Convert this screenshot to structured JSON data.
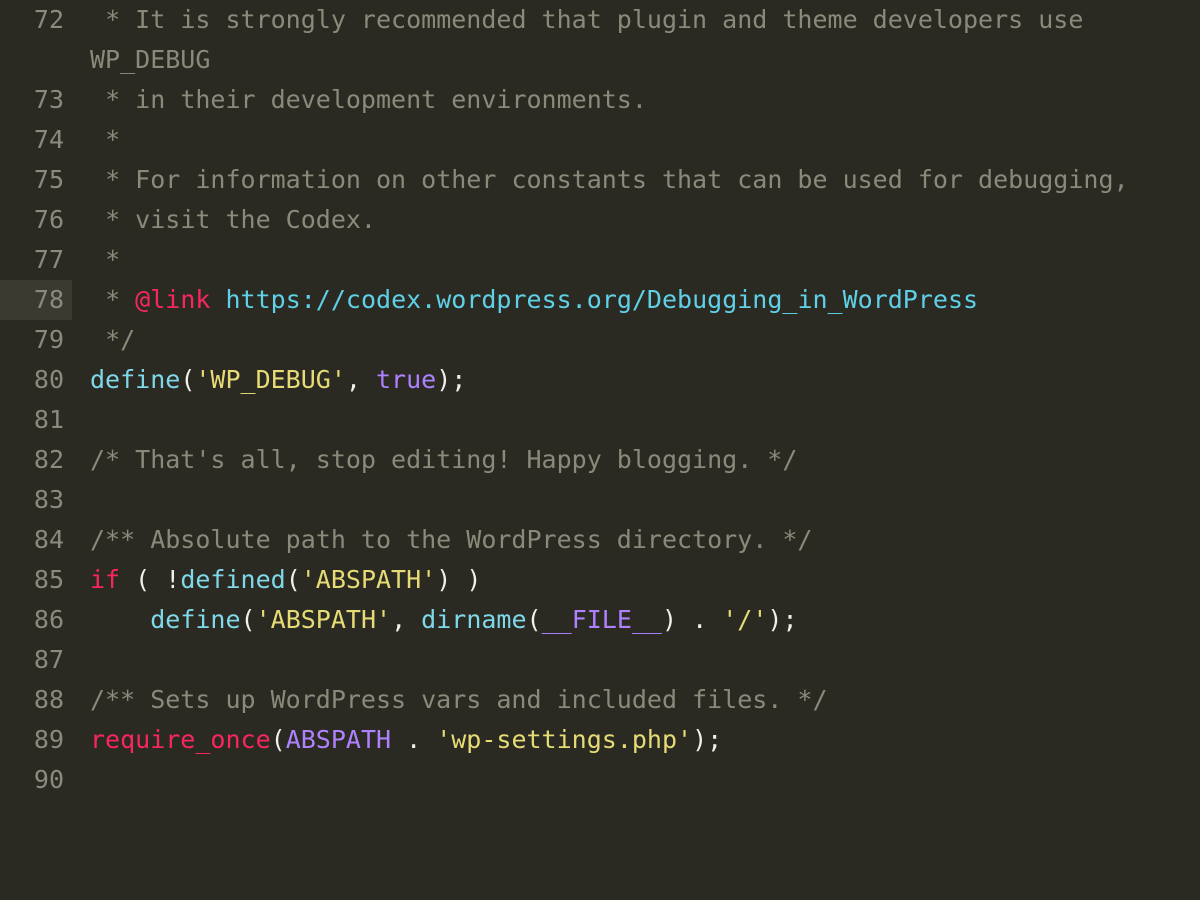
{
  "editor": {
    "highlighted_line": 78,
    "lines": [
      {
        "num": 72,
        "segments": [
          {
            "cls": "tok-comment",
            "text": " * It is strongly recommended that plugin and theme developers use WP_DEBUG"
          }
        ]
      },
      {
        "num": 73,
        "segments": [
          {
            "cls": "tok-comment",
            "text": " * in their development environments."
          }
        ]
      },
      {
        "num": 74,
        "segments": [
          {
            "cls": "tok-comment",
            "text": " *"
          }
        ]
      },
      {
        "num": 75,
        "segments": [
          {
            "cls": "tok-comment",
            "text": " * For information on other constants that can be used for debugging,"
          }
        ]
      },
      {
        "num": 76,
        "segments": [
          {
            "cls": "tok-comment",
            "text": " * visit the Codex."
          }
        ]
      },
      {
        "num": 77,
        "segments": [
          {
            "cls": "tok-comment",
            "text": " *"
          }
        ]
      },
      {
        "num": 78,
        "segments": [
          {
            "cls": "tok-comment",
            "text": " * "
          },
          {
            "cls": "tok-tag",
            "text": "@link"
          },
          {
            "cls": "tok-comment",
            "text": " "
          },
          {
            "cls": "tok-url",
            "text": "https://codex.wordpress.org/Debugging_in_WordPress"
          }
        ]
      },
      {
        "num": 79,
        "segments": [
          {
            "cls": "tok-comment",
            "text": " */"
          }
        ]
      },
      {
        "num": 80,
        "segments": [
          {
            "cls": "tok-func",
            "text": "define"
          },
          {
            "cls": "tok-plain",
            "text": "("
          },
          {
            "cls": "tok-string",
            "text": "'WP_DEBUG'"
          },
          {
            "cls": "tok-plain",
            "text": ", "
          },
          {
            "cls": "tok-const",
            "text": "true"
          },
          {
            "cls": "tok-plain",
            "text": ");"
          }
        ]
      },
      {
        "num": 81,
        "segments": [
          {
            "cls": "tok-plain",
            "text": ""
          }
        ]
      },
      {
        "num": 82,
        "segments": [
          {
            "cls": "tok-comment",
            "text": "/* That's all, stop editing! Happy blogging. */"
          }
        ]
      },
      {
        "num": 83,
        "segments": [
          {
            "cls": "tok-plain",
            "text": ""
          }
        ]
      },
      {
        "num": 84,
        "segments": [
          {
            "cls": "tok-comment",
            "text": "/** Absolute path to the WordPress directory. */"
          }
        ]
      },
      {
        "num": 85,
        "segments": [
          {
            "cls": "tok-keyword",
            "text": "if"
          },
          {
            "cls": "tok-plain",
            "text": " ( !"
          },
          {
            "cls": "tok-func",
            "text": "defined"
          },
          {
            "cls": "tok-plain",
            "text": "("
          },
          {
            "cls": "tok-string",
            "text": "'ABSPATH'"
          },
          {
            "cls": "tok-plain",
            "text": ") )"
          }
        ]
      },
      {
        "num": 86,
        "segments": [
          {
            "cls": "tok-plain",
            "text": "    "
          },
          {
            "cls": "tok-func",
            "text": "define"
          },
          {
            "cls": "tok-plain",
            "text": "("
          },
          {
            "cls": "tok-string",
            "text": "'ABSPATH'"
          },
          {
            "cls": "tok-plain",
            "text": ", "
          },
          {
            "cls": "tok-func",
            "text": "dirname"
          },
          {
            "cls": "tok-plain",
            "text": "("
          },
          {
            "cls": "tok-magic",
            "text": "__FILE__"
          },
          {
            "cls": "tok-plain",
            "text": ") . "
          },
          {
            "cls": "tok-string",
            "text": "'/'"
          },
          {
            "cls": "tok-plain",
            "text": ");"
          }
        ]
      },
      {
        "num": 87,
        "segments": [
          {
            "cls": "tok-plain",
            "text": ""
          }
        ]
      },
      {
        "num": 88,
        "segments": [
          {
            "cls": "tok-comment",
            "text": "/** Sets up WordPress vars and included files. */"
          }
        ]
      },
      {
        "num": 89,
        "segments": [
          {
            "cls": "tok-keyword",
            "text": "require_once"
          },
          {
            "cls": "tok-plain",
            "text": "("
          },
          {
            "cls": "tok-const",
            "text": "ABSPATH"
          },
          {
            "cls": "tok-plain",
            "text": " . "
          },
          {
            "cls": "tok-string",
            "text": "'wp-settings.php'"
          },
          {
            "cls": "tok-plain",
            "text": ");"
          }
        ]
      },
      {
        "num": 90,
        "segments": [
          {
            "cls": "tok-plain",
            "text": ""
          }
        ]
      }
    ]
  }
}
